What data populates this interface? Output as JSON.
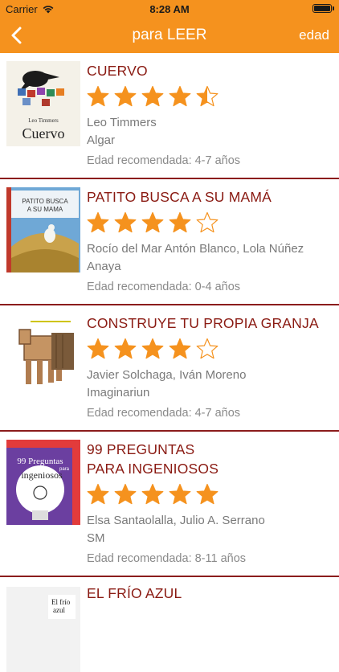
{
  "status": {
    "carrier": "Carrier",
    "time": "8:28 AM"
  },
  "nav": {
    "title": "para LEER",
    "right": "edad"
  },
  "colors": {
    "accent": "#f5921e",
    "title": "#8a1a12",
    "divider": "#8b1c1c"
  },
  "books": [
    {
      "title": "CUERVO",
      "rating": 4.5,
      "author": "Leo Timmers",
      "publisher": "Algar",
      "age": "Edad recomendada: 4-7 años",
      "cover_text": [
        "Leo Timmers",
        "Cuervo"
      ]
    },
    {
      "title": "PATITO BUSCA A SU MAMÁ",
      "rating": 4,
      "author": "Rocío del Mar Antón Blanco, Lola Núñez",
      "publisher": "Anaya",
      "age": "Edad recomendada: 0-4 años",
      "cover_text": [
        "PATITO BUSCA",
        "A SU MAMA"
      ]
    },
    {
      "title": "CONSTRUYE TU PROPIA GRANJA",
      "rating": 4,
      "author": "Javier Solchaga, Iván Moreno",
      "publisher": "Imaginariun",
      "age": "Edad recomendada: 4-7 años"
    },
    {
      "title_lines": [
        "99 PREGUNTAS",
        "PARA INGENIOSOS"
      ],
      "rating": 5,
      "author": "Elsa Santaolalla, Julio A. Serrano",
      "publisher": "SM",
      "age": "Edad recomendada: 8-11 años",
      "cover_text": [
        "99 Preguntas",
        "para",
        "ingeniosos"
      ]
    },
    {
      "title": "EL FRÍO AZUL",
      "cover_text": [
        "El frío",
        "azul"
      ]
    }
  ]
}
